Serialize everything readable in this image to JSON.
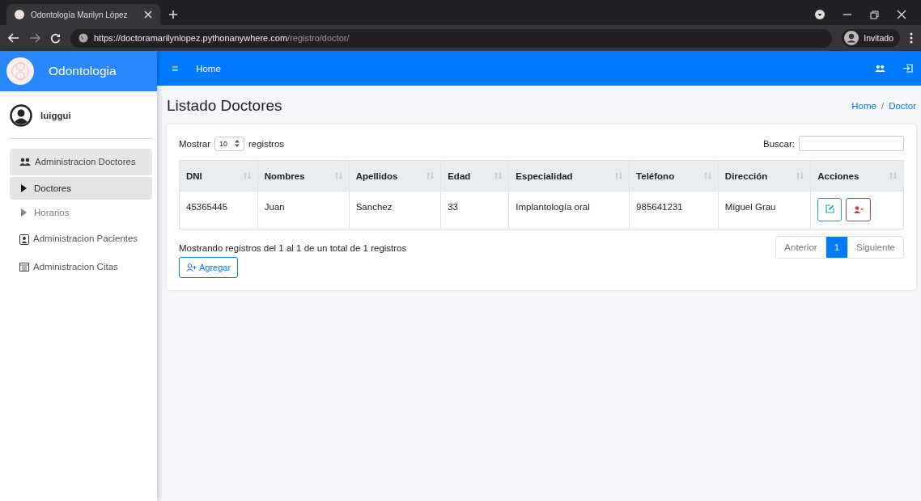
{
  "browser": {
    "tab_title": "Odontología Marilyn López",
    "url_host": "https://doctoramarilynlopez.pythonanywhere.com",
    "url_path": "/registro/doctor/",
    "profile": "Invitado"
  },
  "navbar": {
    "brand": "Odontologia",
    "menu_icon": "≡",
    "link": "Home"
  },
  "sidebar": {
    "user": "luiggui",
    "items": [
      {
        "label": "Administracion Doctores",
        "selected": true,
        "children": [
          {
            "label": "Doctores",
            "selected": true
          },
          {
            "label": "Horarios",
            "selected": false
          }
        ]
      },
      {
        "label": "Administracion Pacientes",
        "selected": false
      },
      {
        "label": "Administracion Citas",
        "selected": false
      }
    ]
  },
  "page": {
    "title": "Listado Doctores",
    "breadcrumb": [
      "Home",
      "Doctor"
    ],
    "breadcrumb_separator": "/"
  },
  "table_controls": {
    "show_label": "Mostrar",
    "page_size": "10",
    "records_label": "registros",
    "search_label": "Buscar:"
  },
  "table": {
    "columns": [
      "DNI",
      "Nombres",
      "Apellidos",
      "Edad",
      "Especialidad",
      "Teléfono",
      "Dirección",
      "Acciones"
    ],
    "rows": [
      [
        "45365445",
        "Juan",
        "Sanchez",
        "33",
        "Implantología oral",
        "985641231",
        "Miguel Grau"
      ]
    ]
  },
  "info": "Mostrando registros del 1 al 1 de un total de 1 registros",
  "pagination": [
    {
      "label": "Anterior",
      "selected": false
    },
    {
      "label": "1",
      "selected": true
    },
    {
      "label": "Siguiente",
      "selected": false
    }
  ],
  "add_button": "Agregar"
}
